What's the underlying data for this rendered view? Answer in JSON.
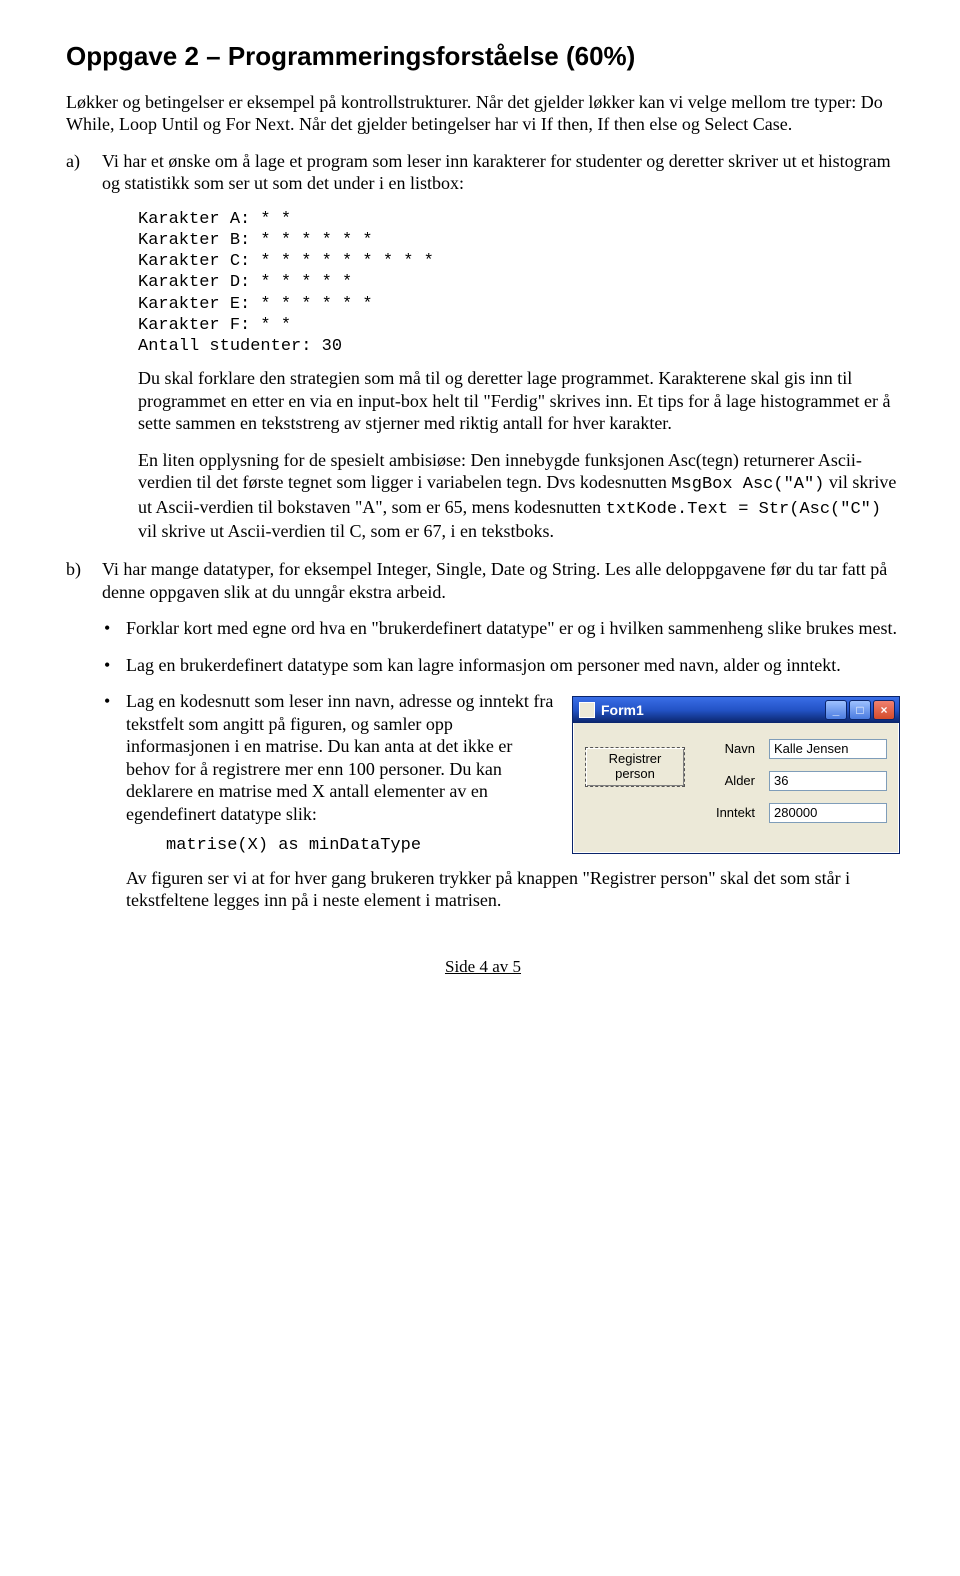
{
  "heading": "Oppgave 2 – Programmeringsforståelse (60%)",
  "intro1": "Løkker og betingelser er eksempel på kontrollstrukturer. Når det gjelder løkker kan vi velge mellom tre typer: Do While, Loop Until og For Next. Når det gjelder betingelser har vi If then, If then else og Select Case.",
  "a": {
    "marker": "a)",
    "p1": "Vi har et ønske om å lage et program som leser inn karakterer for studenter og deretter skriver ut et histogram og statistikk som ser ut som det under i en listbox:",
    "listing": "Karakter A: * *\nKarakter B: * * * * * *\nKarakter C: * * * * * * * * *\nKarakter D: * * * * *\nKarakter E: * * * * * *\nKarakter F: * *\nAntall studenter: 30",
    "p2": "Du skal forklare den strategien som må til og deretter lage programmet. Karakterene skal gis inn til programmet en etter en via en input-box helt til \"Ferdig\" skrives inn. Et tips for å lage histogrammet er å sette sammen en tekststreng av stjerner med riktig antall for hver karakter.",
    "p3_pre": "En liten opplysning for de spesielt ambisiøse: Den innebygde funksjonen Asc(tegn) returnerer Ascii-verdien til det første tegnet som ligger i variabelen tegn. Dvs kodesnutten ",
    "code1": "MsgBox Asc(\"A\")",
    "p3_mid": " vil skrive ut Ascii-verdien til bokstaven \"A\", som er 65, mens kodesnutten ",
    "code2": "txtKode.Text = Str(Asc(\"C\")",
    "p3_post": " vil skrive ut Ascii-verdien til C, som er 67, i en tekstboks."
  },
  "b": {
    "marker": "b)",
    "p1": "Vi har mange datatyper, for eksempel Integer, Single, Date og String. Les alle deloppgavene før du tar fatt på denne oppgaven slik at du unngår ekstra arbeid.",
    "bullets": {
      "b1": "Forklar kort med egne ord hva en \"brukerdefinert datatype\" er og i hvilken sammenheng slike brukes mest.",
      "b2": "Lag en brukerdefinert datatype som kan lagre informasjon om personer med navn, alder og inntekt.",
      "b3": "Lag en kodesnutt som leser inn navn, adresse og inntekt fra tekstfelt som angitt på figuren, og samler opp informasjonen i en matrise. Du kan anta at det ikke er behov for å registrere mer enn 100 personer. Du kan deklarere en matrise med X antall elementer av en egendefinert datatype slik:"
    },
    "code": "matrise(X) as minDataType",
    "p_after": "Av figuren ser vi at for hver gang brukeren trykker på knappen \"Registrer person\" skal det som står i tekstfeltene legges inn på i neste element i matrisen."
  },
  "form": {
    "title": "Form1",
    "button": "Registrer person",
    "labels": {
      "navn": "Navn",
      "alder": "Alder",
      "inntekt": "Inntekt"
    },
    "values": {
      "navn": "Kalle Jensen",
      "alder": "36",
      "inntekt": "280000"
    }
  },
  "footer": "Side 4 av 5"
}
